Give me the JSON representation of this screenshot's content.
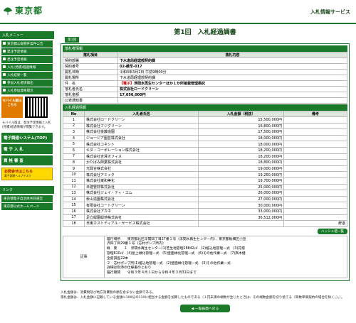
{
  "header": {
    "logo_text": "東京都",
    "site_name": "入札情報サービス"
  },
  "sidebar": {
    "menu_heading": "入札メニュー",
    "items": [
      {
        "label": "東京都公報物件案件公告",
        "icon": "bullet-icon"
      },
      {
        "label": "発注予定情報",
        "icon": "bullet-icon"
      },
      {
        "label": "発注予定情報",
        "icon": "bullet-icon"
      },
      {
        "label": "入札(見積)経過情報",
        "icon": "bullet-icon"
      },
      {
        "label": "入札結果一覧",
        "icon": "bullet-icon"
      },
      {
        "label": "参加入札者情報出",
        "icon": "bullet-icon"
      },
      {
        "label": "入札参加資格開示",
        "icon": "bullet-icon"
      }
    ],
    "mobile": {
      "label": "モバイル版はこちら"
    },
    "mobile_note": "モバイル版は、発注予定情報と入札(見積)経過情報が閲覧できます。",
    "system_label": "電子調達システム(TOP)",
    "nyusatsu_label": "電 子 入 札",
    "shikaku_label": "資 格 審 査",
    "promo": {
      "title": "お問合せはこちら",
      "sub": "電子調達ヘルプデスク"
    },
    "links_heading": "リンク",
    "links": [
      "東京都電子自治体共同運営",
      "東京都公式ホームページ"
    ]
  },
  "main": {
    "title": "第1回　入札経過調書",
    "round_tab": "第1回",
    "info_section": "落札者情報",
    "info_headers": [
      "落札項目",
      "落札内容"
    ],
    "info_rows": [
      {
        "key": "契約部署",
        "value": "下水道局経理部契約課"
      },
      {
        "key": "契約番号",
        "value": "02-維早-017"
      },
      {
        "key": "開札日時",
        "value": "令和3年3月2日 午前9時00分"
      },
      {
        "key": "開札場所",
        "value": "下水道局経理部契約課"
      },
      {
        "key": "件　名",
        "tag": "【電子】",
        "value": "浮間水再生センターほか１か所植栽管理委託"
      },
      {
        "key": "落札者氏名",
        "value": "株式会社ロードクリーン"
      },
      {
        "key": "落札金額",
        "value": "17,050,000円"
      },
      {
        "key": "公表通知書",
        "value": ""
      }
    ],
    "bid_section": "入札経過情報",
    "bid_headers": [
      "No",
      "入札者氏名",
      "入札金額（税抜）",
      "備考"
    ],
    "bids": [
      {
        "no": "1",
        "name": "株式会社ロードクリーン",
        "amount": "15,500,000円",
        "note": ""
      },
      {
        "no": "2",
        "name": "株式会社フジグリーン",
        "amount": "16,800,000円",
        "note": ""
      },
      {
        "no": "3",
        "name": "株式会社後藤造園",
        "amount": "17,500,000円",
        "note": ""
      },
      {
        "no": "4",
        "name": "ジョージア園芸株式会社",
        "amount": "18,000,000円",
        "note": ""
      },
      {
        "no": "5",
        "name": "株式会社コネシト",
        "amount": "18,000,000円",
        "note": ""
      },
      {
        "no": "6",
        "name": "キヌ・コーポレーション株式会社",
        "amount": "18,200,000円",
        "note": ""
      },
      {
        "no": "7",
        "name": "株式会社吉澤オフィス",
        "amount": "18,200,000円",
        "note": ""
      },
      {
        "no": "8",
        "name": "かたばみ興業株式会社",
        "amount": "18,800,000円",
        "note": ""
      },
      {
        "no": "9",
        "name": "光興合株式会社",
        "amount": "19,000,000円",
        "note": ""
      },
      {
        "no": "10",
        "name": "株式会社アミック",
        "amount": "19,250,000円",
        "note": ""
      },
      {
        "no": "11",
        "name": "株式会社東和美化",
        "amount": "19,700,000円",
        "note": ""
      },
      {
        "no": "12",
        "name": "日建管財株式会社",
        "amount": "25,000,000円",
        "note": ""
      },
      {
        "no": "13",
        "name": "株式会社ジェイ・ティ・エム",
        "amount": "26,000,000円",
        "note": ""
      },
      {
        "no": "14",
        "name": "秋山造園株式会社",
        "amount": "27,000,000円",
        "note": ""
      },
      {
        "no": "15",
        "name": "有限会社コートグリーン",
        "amount": "30,000,000円",
        "note": ""
      },
      {
        "no": "16",
        "name": "株式会社アカネ",
        "amount": "33,000,000円",
        "note": ""
      },
      {
        "no": "17",
        "name": "足立緑園緑地株式会社",
        "amount": "36,512,000円",
        "note": ""
      },
      {
        "no": "18",
        "name": "日東カストディアル・サービス株式会社",
        "amount": "",
        "note": "辞退"
      }
    ],
    "hashira_button": "ハッシュ値一覧",
    "remarks_key": "記事",
    "remarks_text": "履行場所　　東京都北区浮間四丁目27番１号（浮間水再生センター内）、東京都板橋区小豆\n沢四丁目29番１号（志村ポンプ所内）\n概　要　　１　浮間水再生センター(1)芝生地管理18842㎡　(2)植込地管理一式　(3)花壇\n管理610㎡　(4)屋上緑化管理一式　(5)壁面緑化管理一式　(6)その他作業一式　(7)高木健\n全度調査22本\n２　志村ポンプ所(1)植込地管理一式　(2)壁面緑化管理一式　(3)その他作業一式\n詳細は別添の仕様書のとおり\n履行期間　　令和３年４月１日から令和４年３月31日まで",
    "footnote": "入札金額は、消費税及び地方消費税の額を含まない金額である。\n落札金額は、入札金額に記載している金額に100分の110に相当する金額を加算したものである（１円未満の端数が生じたときは、その端数金額を切り捨てる（単数単価契約の場合を除く。）。）。",
    "back_button": "一覧画面へ戻る"
  },
  "colors": {
    "brand": "#1a7a2a",
    "header_bg": "#dde7dd"
  }
}
